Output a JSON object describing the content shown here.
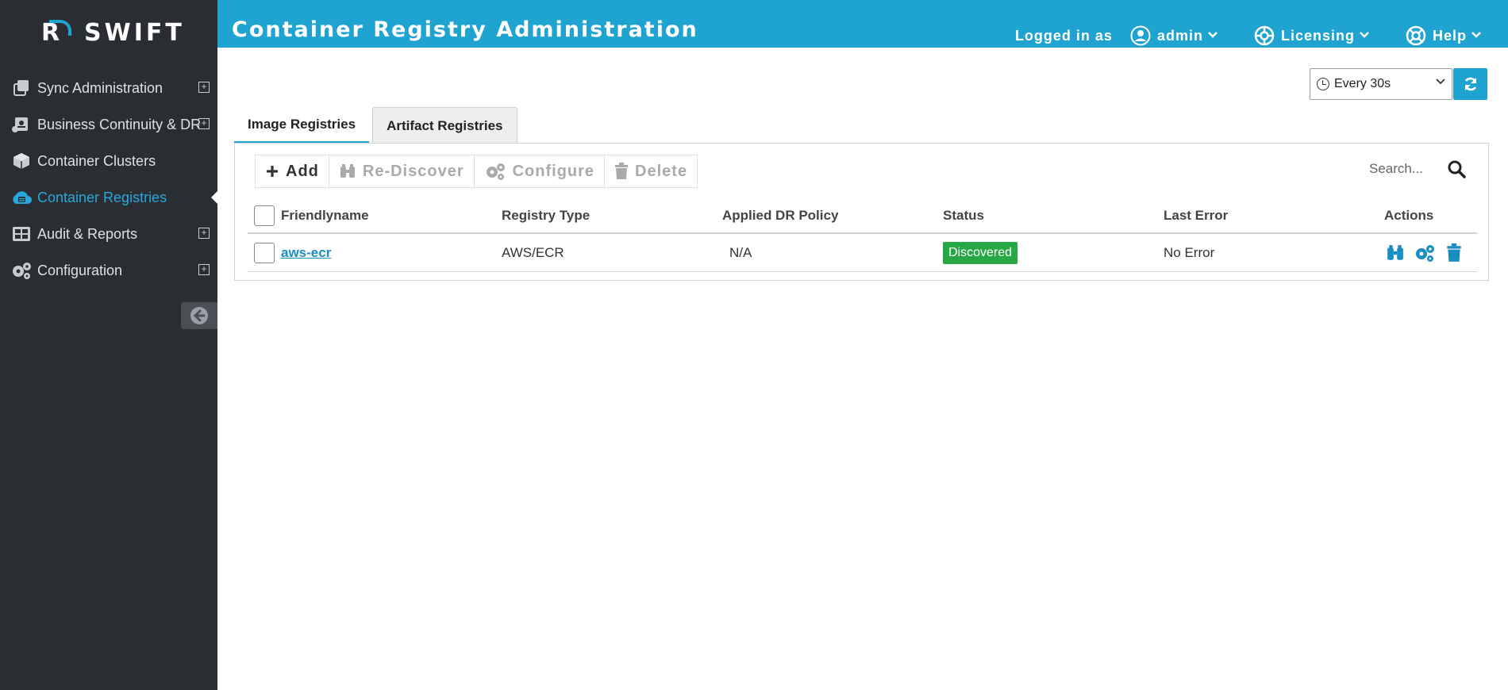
{
  "app": {
    "logo_text": "SWIFT",
    "logo_mark": "R",
    "page_title": "Container Registry Administration"
  },
  "sidebar": {
    "items": [
      {
        "label": "Sync Administration",
        "icon": "copy-icon",
        "expandable": true,
        "active": false
      },
      {
        "label": "Business Continuity & DR",
        "icon": "scroll-icon",
        "expandable": true,
        "active": false
      },
      {
        "label": "Container Clusters",
        "icon": "cube-icon",
        "expandable": false,
        "active": false
      },
      {
        "label": "Container Registries",
        "icon": "cloud-icon",
        "expandable": false,
        "active": true
      },
      {
        "label": "Audit & Reports",
        "icon": "table-icon",
        "expandable": true,
        "active": false
      },
      {
        "label": "Configuration",
        "icon": "gears-icon",
        "expandable": true,
        "active": false
      }
    ],
    "expand_symbol": "+"
  },
  "header": {
    "logged_in_label": "Logged in as",
    "user": "admin",
    "licensing": "Licensing",
    "help": "Help"
  },
  "refresh": {
    "interval": "Every 30s"
  },
  "tabs": [
    {
      "label": "Image Registries",
      "active": true
    },
    {
      "label": "Artifact Registries",
      "active": false
    }
  ],
  "toolbar": {
    "add": "Add",
    "rediscover": "Re-Discover",
    "configure": "Configure",
    "delete": "Delete"
  },
  "search": {
    "placeholder": "Search..."
  },
  "table": {
    "columns": [
      "Friendlyname",
      "Registry Type",
      "Applied DR Policy",
      "Status",
      "Last Error",
      "Actions"
    ],
    "rows": [
      {
        "name": "aws-ecr",
        "type": "AWS/ECR",
        "policy": "N/A",
        "status": "Discovered",
        "error": "No Error"
      }
    ]
  },
  "colors": {
    "brand": "#1fa3d0",
    "sidebar_bg": "#2a2e33",
    "status_ok": "#28a745",
    "active_nav": "#27a7dc"
  }
}
